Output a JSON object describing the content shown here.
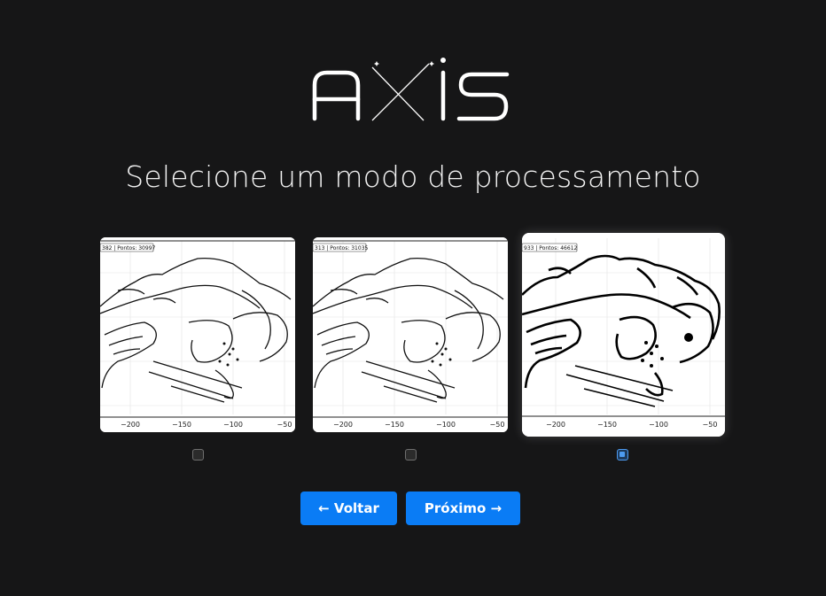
{
  "brand": {
    "logo_text": "AXIS"
  },
  "heading": "Selecione um modo de processamento",
  "options": [
    {
      "info": "382 | Pontos: 30997",
      "ticks": [
        "−200",
        "−150",
        "−100",
        "−50"
      ],
      "selected": false
    },
    {
      "info": "313 | Pontos: 31035",
      "ticks": [
        "−200",
        "−150",
        "−100",
        "−50"
      ],
      "selected": false
    },
    {
      "info": "933 | Pontos: 46612",
      "ticks": [
        "−200",
        "−150",
        "−100",
        "−50"
      ],
      "selected": true
    }
  ],
  "nav": {
    "back_label": "← Voltar",
    "next_label": "Próximo →"
  },
  "colors": {
    "background": "#161617",
    "accent": "#0a7cf5",
    "checked": "#4d9bf0"
  }
}
